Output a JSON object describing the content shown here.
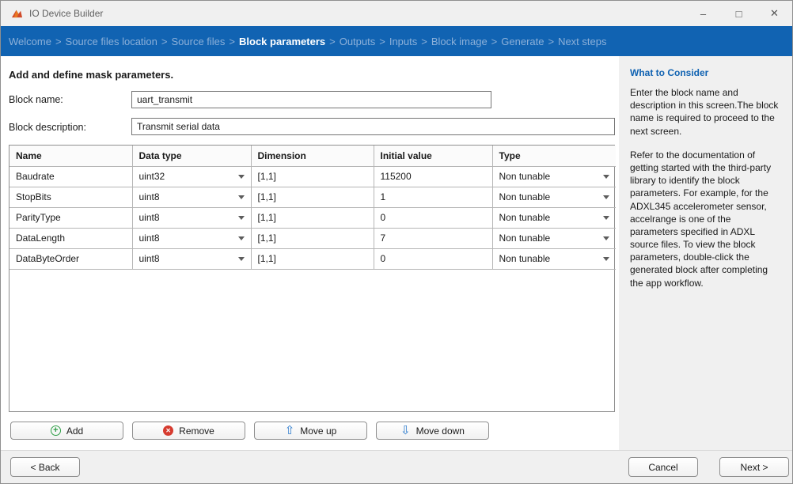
{
  "window": {
    "title": "IO Device Builder",
    "controls": {
      "minimize": "–",
      "maximize": "□",
      "close": "✕"
    }
  },
  "breadcrumb": {
    "separator": ">",
    "active": "Block parameters",
    "items": [
      "Welcome",
      "Source files location",
      "Source files",
      "Block parameters",
      "Outputs",
      "Inputs",
      "Block image",
      "Generate",
      "Next steps"
    ]
  },
  "main": {
    "heading": "Add and define mask parameters.",
    "block_name_label": "Block name:",
    "block_name_value": "uart_transmit",
    "block_description_label": "Block description:",
    "block_description_value": "Transmit serial data",
    "table": {
      "columns": [
        "Name",
        "Data type",
        "Dimension",
        "Initial value",
        "Type"
      ],
      "rows": [
        {
          "name": "Baudrate",
          "data_type": "uint32",
          "dimension": "[1,1]",
          "initial_value": "115200",
          "type": "Non tunable"
        },
        {
          "name": "StopBits",
          "data_type": "uint8",
          "dimension": "[1,1]",
          "initial_value": "1",
          "type": "Non tunable"
        },
        {
          "name": "ParityType",
          "data_type": "uint8",
          "dimension": "[1,1]",
          "initial_value": "0",
          "type": "Non tunable"
        },
        {
          "name": "DataLength",
          "data_type": "uint8",
          "dimension": "[1,1]",
          "initial_value": "7",
          "type": "Non tunable"
        },
        {
          "name": "DataByteOrder",
          "data_type": "uint8",
          "dimension": "[1,1]",
          "initial_value": "0",
          "type": "Non tunable"
        }
      ]
    },
    "buttons": {
      "add": "Add",
      "remove": "Remove",
      "move_up": "Move up",
      "move_down": "Move down"
    }
  },
  "sidebar": {
    "heading": "What to Consider",
    "paragraphs": [
      "Enter the block name and description in this screen.The block name is required to proceed to the next screen.",
      "Refer to the documentation of getting started with the third-party library to identify the block parameters. For example, for the ADXL345 accelerometer sensor, accelrange is one of the parameters specified in ADXL source files. To view the block parameters, double-click the generated block after completing the app workflow."
    ]
  },
  "footer": {
    "back": "< Back",
    "cancel": "Cancel",
    "next": "Next >"
  },
  "icons": {
    "app": "matlab-membrane",
    "add": "plus-circle-green",
    "remove": "cross-circle-red",
    "move_up": "hollow-up-arrow-blue",
    "move_down": "hollow-down-arrow-blue",
    "dropdown": "chevron-down"
  },
  "colors": {
    "accent_blue": "#1163b2",
    "breadcrumb_inactive": "#8cb0d9",
    "add_green": "#2e9e46",
    "remove_red": "#d63b2f",
    "arrow_blue": "#2878cc",
    "sidebar_bg": "#f0f0f0"
  }
}
